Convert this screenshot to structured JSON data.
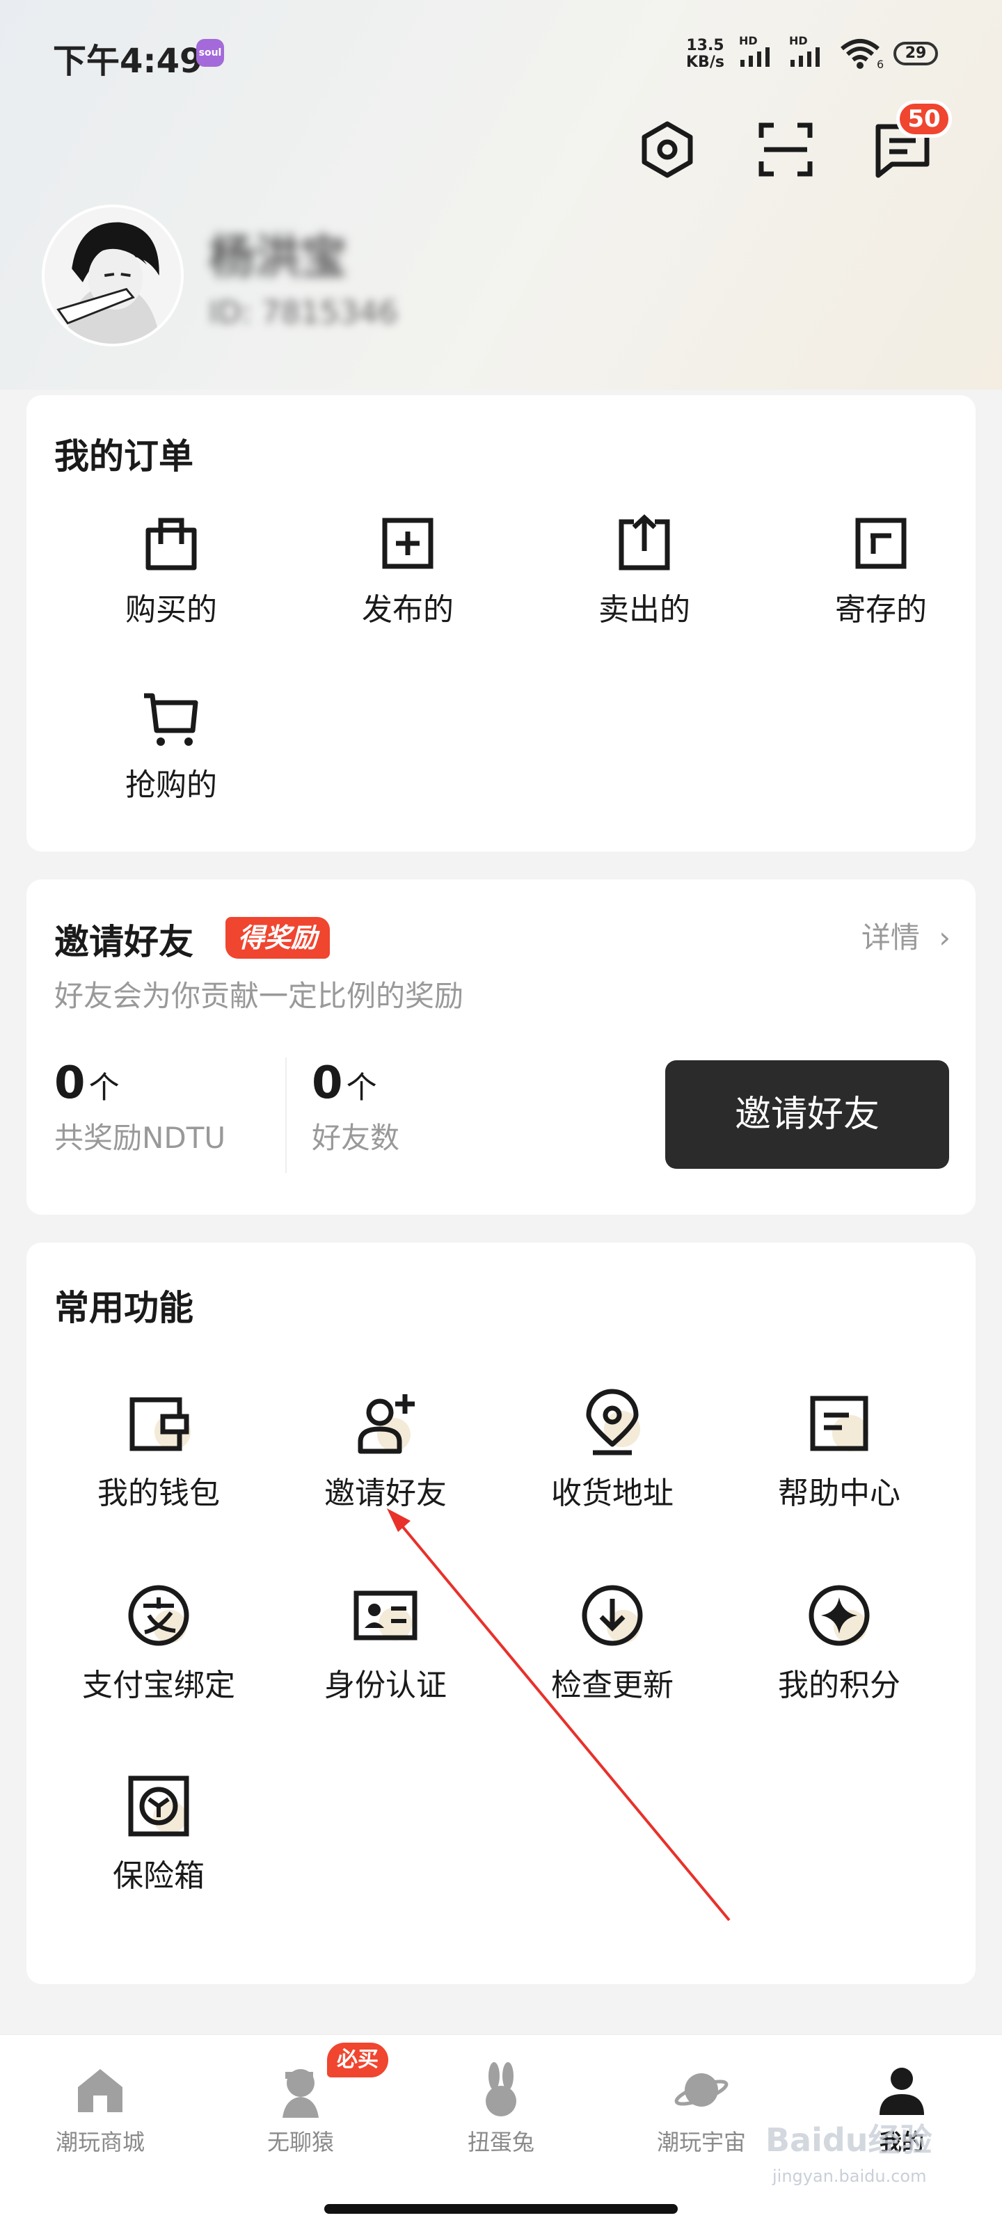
{
  "status_bar": {
    "time": "下午4:49",
    "app_badge": "soul",
    "network_speed_top": "13.5",
    "network_speed_unit": "KB/s",
    "hd_label": "HD",
    "wifi_sub": "6",
    "battery": "29"
  },
  "header": {
    "message_count": "50",
    "icons": [
      "settings-icon",
      "scan-icon",
      "message-icon"
    ]
  },
  "profile": {
    "username": "杨洪宝",
    "user_id": "ID: 7815346"
  },
  "orders": {
    "title": "我的订单",
    "items": [
      {
        "label": "购买的",
        "icon": "bag-icon"
      },
      {
        "label": "发布的",
        "icon": "publish-icon"
      },
      {
        "label": "卖出的",
        "icon": "sold-icon"
      },
      {
        "label": "寄存的",
        "icon": "storage-icon"
      },
      {
        "label": "抢购的",
        "icon": "cart-icon"
      }
    ]
  },
  "invite": {
    "title": "邀请好友",
    "tag": "得奖励",
    "detail": "详情",
    "subtitle": "好友会为你贡献一定比例的奖励",
    "stat1_value": "0",
    "stat1_unit": "个",
    "stat1_label": "共奖励NDTU",
    "stat2_value": "0",
    "stat2_unit": "个",
    "stat2_label": "好友数",
    "button": "邀请好友"
  },
  "functions": {
    "title": "常用功能",
    "items": [
      {
        "label": "我的钱包",
        "icon": "wallet-icon"
      },
      {
        "label": "邀请好友",
        "icon": "add-user-icon"
      },
      {
        "label": "收货地址",
        "icon": "location-icon"
      },
      {
        "label": "帮助中心",
        "icon": "help-doc-icon"
      },
      {
        "label": "支付宝绑定",
        "icon": "alipay-icon"
      },
      {
        "label": "身份认证",
        "icon": "id-card-icon"
      },
      {
        "label": "检查更新",
        "icon": "update-icon"
      },
      {
        "label": "我的积分",
        "icon": "points-icon"
      },
      {
        "label": "保险箱",
        "icon": "safe-icon"
      }
    ]
  },
  "tabbar": {
    "tabs": [
      {
        "label": "潮玩商城",
        "icon": "home-icon"
      },
      {
        "label": "无聊猿",
        "icon": "ape-icon"
      },
      {
        "label": "扭蛋兔",
        "icon": "rabbit-icon"
      },
      {
        "label": "潮玩宇宙",
        "icon": "planet-icon"
      },
      {
        "label": "我的",
        "icon": "profile-icon"
      }
    ],
    "must_buy_badge": "必买",
    "active_index": 4
  },
  "watermark": {
    "text": "Baidu经验",
    "sub": "jingyan.baidu.com"
  },
  "colors": {
    "accent_red": "#f0452f",
    "dark_button": "#2b2b2b",
    "muted_text": "#999999"
  }
}
